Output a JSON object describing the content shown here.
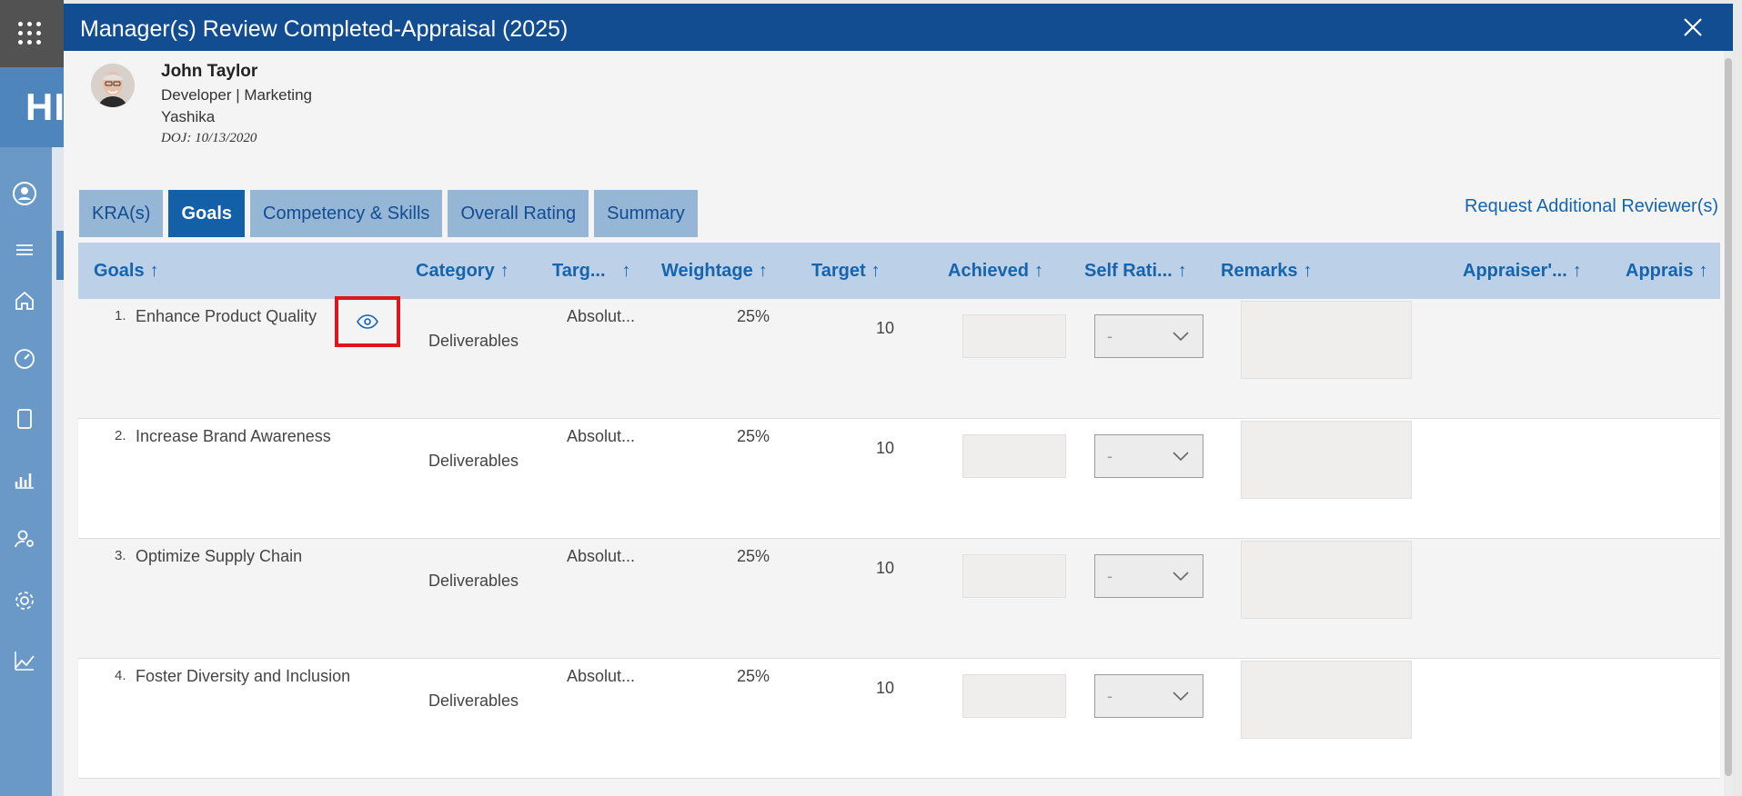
{
  "app": {
    "brand_text": "HI"
  },
  "panel": {
    "title": "Manager(s) Review Completed-Appraisal (2025)"
  },
  "employee": {
    "name": "John Taylor",
    "role": "Developer | Marketing",
    "company": "Yashika",
    "doj": "DOJ: 10/13/2020"
  },
  "tabs": [
    {
      "label": "KRA(s)",
      "active": false
    },
    {
      "label": "Goals",
      "active": true
    },
    {
      "label": "Competency & Skills",
      "active": false
    },
    {
      "label": "Overall Rating",
      "active": false
    },
    {
      "label": "Summary",
      "active": false
    }
  ],
  "request_link": "Request Additional Reviewer(s)",
  "columns": {
    "goals": "Goals",
    "category": "Category",
    "target_type": "Targ...",
    "weightage": "Weightage",
    "target": "Target",
    "achieved": "Achieved",
    "self_rating": "Self Rati...",
    "remarks": "Remarks",
    "appraiser": "Appraiser'...",
    "appraiser2": "Apprais",
    "sort_arrow": "↑"
  },
  "rows": [
    {
      "no": "1.",
      "goal": "Enhance Product Quality",
      "category": "Deliverables",
      "target_type": "Absolut...",
      "weightage": "25%",
      "target": "10",
      "self_rating": "-"
    },
    {
      "no": "2.",
      "goal": "Increase Brand Awareness",
      "category": "Deliverables",
      "target_type": "Absolut...",
      "weightage": "25%",
      "target": "10",
      "self_rating": "-"
    },
    {
      "no": "3.",
      "goal": "Optimize Supply Chain",
      "category": "Deliverables",
      "target_type": "Absolut...",
      "weightage": "25%",
      "target": "10",
      "self_rating": "-"
    },
    {
      "no": "4.",
      "goal": "Foster Diversity and Inclusion",
      "category": "Deliverables",
      "target_type": "Absolut...",
      "weightage": "25%",
      "target": "10",
      "self_rating": "-"
    }
  ],
  "icons": {
    "rail": [
      "profile-icon",
      "menu-icon",
      "home-icon",
      "dashboard-icon",
      "document-icon",
      "analytics-icon",
      "user-settings-icon",
      "settings-icon",
      "trend-icon"
    ],
    "view": "eye-icon",
    "close": "close-icon"
  },
  "colors": {
    "header_bg": "#124c91",
    "tab_active": "#1460a8",
    "tab_inactive": "#96b6d6",
    "table_header": "#bcd1e7",
    "link": "#1564b0",
    "highlight": "#e0141b"
  }
}
